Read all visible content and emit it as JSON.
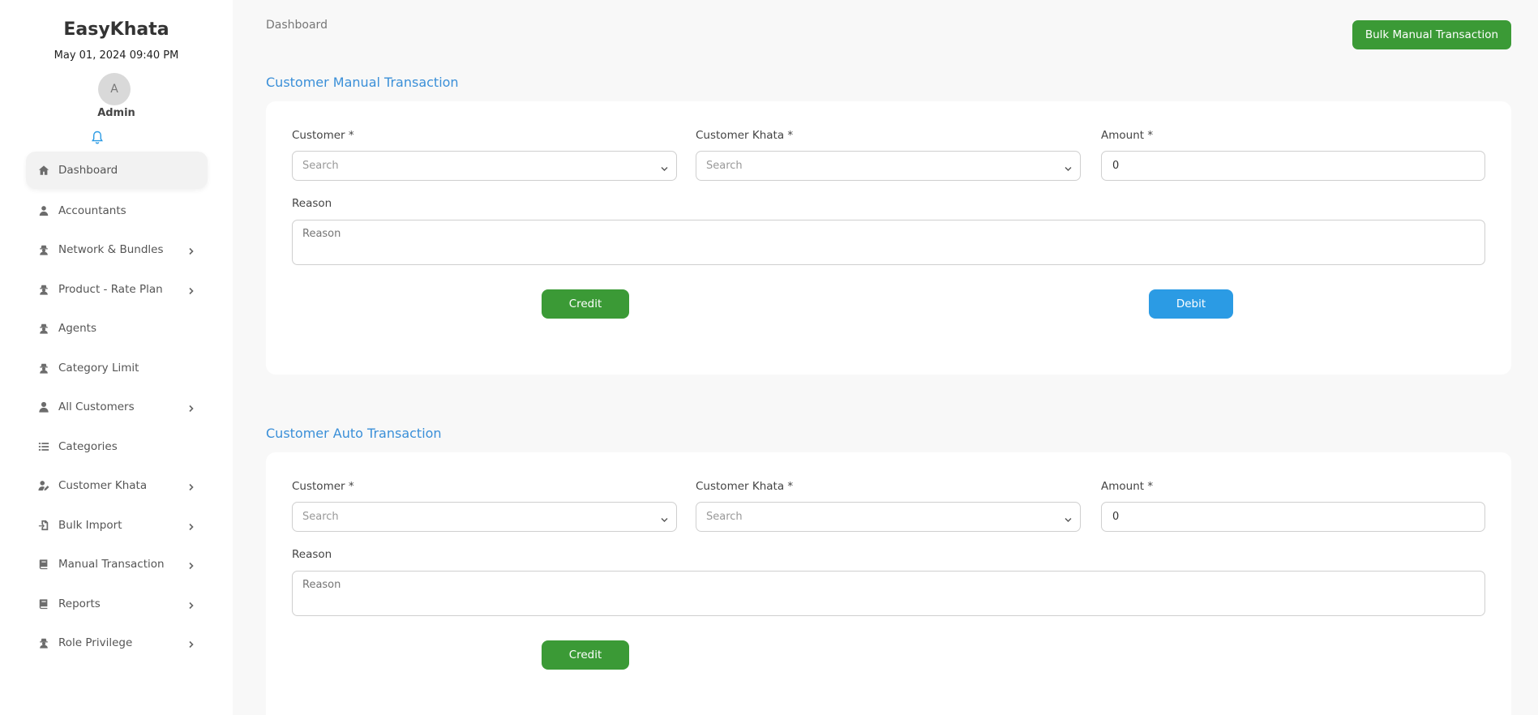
{
  "sidebar": {
    "brand": "EasyKhata",
    "datetime": "May 01, 2024 09:40 PM",
    "avatar_initial": "A",
    "user_name": "Admin",
    "items": [
      {
        "label": "Dashboard",
        "icon": "home-icon",
        "has_submenu": false,
        "active": true
      },
      {
        "label": "Accountants",
        "icon": "user-tie-icon",
        "has_submenu": false
      },
      {
        "label": "Network & Bundles",
        "icon": "user-secret-icon",
        "has_submenu": true
      },
      {
        "label": "Product - Rate Plan",
        "icon": "user-secret-icon",
        "has_submenu": true
      },
      {
        "label": "Agents",
        "icon": "user-secret-icon",
        "has_submenu": false
      },
      {
        "label": "Category Limit",
        "icon": "user-secret-icon",
        "has_submenu": false
      },
      {
        "label": "All Customers",
        "icon": "user-icon",
        "has_submenu": true
      },
      {
        "label": "Categories",
        "icon": "list-icon",
        "has_submenu": false
      },
      {
        "label": "Customer Khata",
        "icon": "user-edit-icon",
        "has_submenu": true
      },
      {
        "label": "Bulk Import",
        "icon": "file-import-icon",
        "has_submenu": true
      },
      {
        "label": "Manual Transaction",
        "icon": "book-icon",
        "has_submenu": true
      },
      {
        "label": "Reports",
        "icon": "book-icon",
        "has_submenu": true
      },
      {
        "label": "Role Privilege",
        "icon": "user-secret-icon",
        "has_submenu": true
      }
    ]
  },
  "header": {
    "breadcrumb": "Dashboard",
    "bulk_button": "Bulk Manual Transaction"
  },
  "manual": {
    "title": "Customer Manual Transaction",
    "customer_label": "Customer *",
    "customer_placeholder": "Search",
    "khata_label": "Customer Khata *",
    "khata_placeholder": "Search",
    "amount_label": "Amount *",
    "amount_value": "0",
    "reason_label": "Reason",
    "reason_placeholder": "Reason",
    "credit_label": "Credit",
    "debit_label": "Debit"
  },
  "auto": {
    "title": "Customer Auto Transaction",
    "customer_label": "Customer *",
    "customer_placeholder": "Search",
    "khata_label": "Customer Khata *",
    "khata_placeholder": "Search",
    "amount_label": "Amount *",
    "amount_value": "0",
    "reason_label": "Reason",
    "reason_placeholder": "Reason",
    "credit_label": "Credit"
  },
  "colors": {
    "accent_green": "#3b9a36",
    "accent_blue": "#2b9be4",
    "title_blue": "#3a8fd8"
  }
}
